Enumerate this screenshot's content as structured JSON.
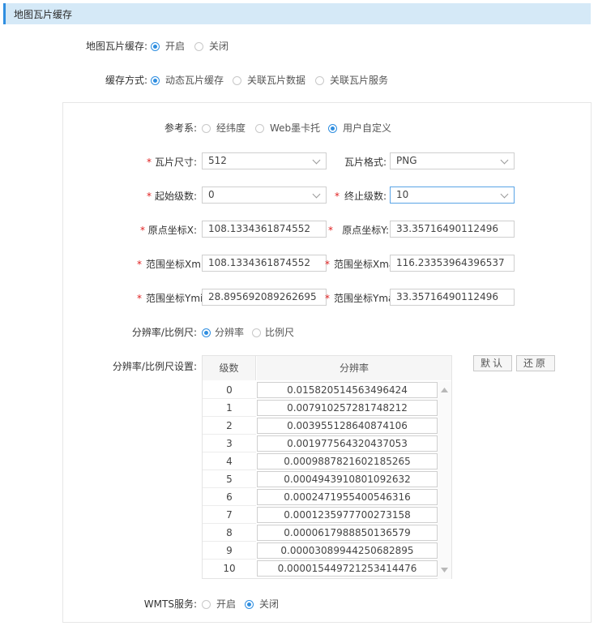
{
  "header": {
    "title": "地图瓦片缓存"
  },
  "cache_enable": {
    "label": "地图瓦片缓存:",
    "options": [
      "开启",
      "关闭"
    ],
    "selected": "开启"
  },
  "cache_mode": {
    "label": "缓存方式:",
    "options": [
      "动态瓦片缓存",
      "关联瓦片数据",
      "关联瓦片服务"
    ],
    "selected": "动态瓦片缓存"
  },
  "crs": {
    "label": "参考系:",
    "options": [
      "经纬度",
      "Web墨卡托",
      "用户自定义"
    ],
    "selected": "用户自定义"
  },
  "tile_size": {
    "label": "瓦片尺寸:",
    "value": "512",
    "required": "*"
  },
  "tile_format": {
    "label": "瓦片格式:",
    "value": "PNG"
  },
  "start_level": {
    "label": "起始级数:",
    "value": "0",
    "required": "*"
  },
  "end_level": {
    "label": "终止级数:",
    "value": "10",
    "required": "*"
  },
  "origin_x": {
    "label": "原点坐标X:",
    "value": "108.1334361874552",
    "required": "*"
  },
  "origin_y": {
    "label": "原点坐标Y:",
    "value": "33.35716490112496",
    "required": "*"
  },
  "xmin": {
    "label": "范围坐标Xmi",
    "value": "108.1334361874552",
    "required": "*"
  },
  "xmax": {
    "label": "范围坐标Xma",
    "value": "116.23353964396537",
    "required": "*"
  },
  "ymin": {
    "label": "范围坐标Ymi",
    "value": "28.895692089262695",
    "required": "*"
  },
  "ymax": {
    "label": "范围坐标Yma",
    "value": "33.35716490112496",
    "required": "*"
  },
  "scale_type": {
    "label": "分辨率/比例尺:",
    "options": [
      "分辨率",
      "比例尺"
    ],
    "selected": "分辨率"
  },
  "scale_settings": {
    "label": "分辨率/比例尺设置:",
    "columns": [
      "级数",
      "分辨率"
    ],
    "rows": [
      {
        "level": "0",
        "resolution": "0.015820514563496424"
      },
      {
        "level": "1",
        "resolution": "0.007910257281748212"
      },
      {
        "level": "2",
        "resolution": "0.003955128640874106"
      },
      {
        "level": "3",
        "resolution": "0.001977564320437053"
      },
      {
        "level": "4",
        "resolution": "0.0009887821602185265"
      },
      {
        "level": "5",
        "resolution": "0.0004943910801092632"
      },
      {
        "level": "6",
        "resolution": "0.0002471955400546316"
      },
      {
        "level": "7",
        "resolution": "0.0001235977700273158"
      },
      {
        "level": "8",
        "resolution": "0.0000617988850136579"
      },
      {
        "level": "9",
        "resolution": "0.00003089944250682895"
      },
      {
        "level": "10",
        "resolution": "0.000015449721253414476"
      }
    ],
    "default_button": "默认",
    "restore_button": "还原"
  },
  "wmts": {
    "label": "WMTS服务:",
    "options": [
      "开启",
      "关闭"
    ],
    "selected": "关闭"
  },
  "colors": {
    "accent": "#2f8ee0",
    "header_bg": "#d5e9f7",
    "required": "#e02020"
  },
  "icons": {
    "dropdown": "chevron-down-icon",
    "scroll_up": "scroll-up-arrow-icon",
    "scroll_down": "scroll-down-arrow-icon"
  }
}
